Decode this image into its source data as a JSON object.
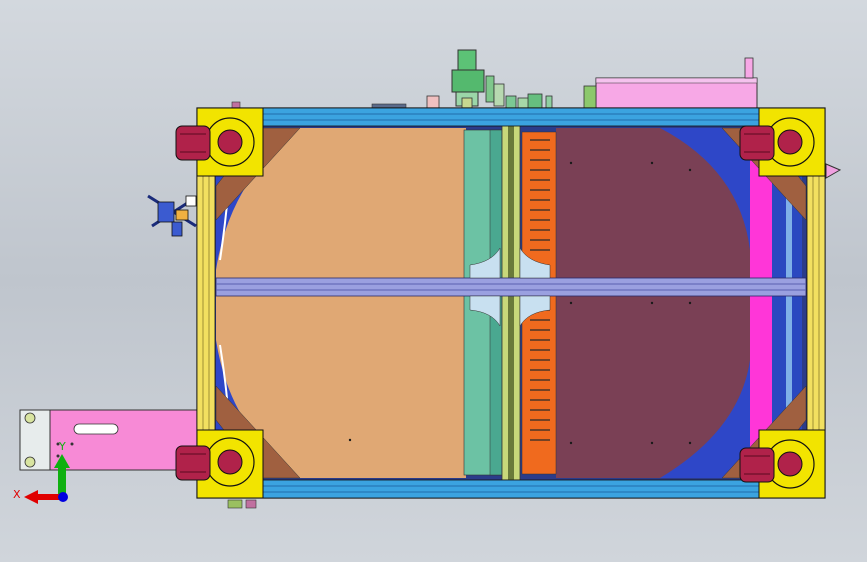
{
  "viewport": {
    "background_top": "#d3d8de",
    "background_bottom": "#bfc5cd"
  },
  "triad": {
    "x_label": "X",
    "y_label": "Y",
    "x_color": "#e00000",
    "y_color": "#10b010",
    "z_color": "#0000e0"
  },
  "colors": {
    "frame_blue": "#3ba3e0",
    "frame_dark": "#1a2b7a",
    "platter_left": "#e0a874",
    "platter_right": "#7a4055",
    "teal_panel": "#6cc2a4",
    "orange_rack": "#f06a1e",
    "caster_red": "#b0224a",
    "corner_yellow": "#f2e400",
    "magenta_panel": "#ff36d8",
    "pink_plate": "#f78ad6",
    "crossbar_lavender": "#9aa0e0"
  },
  "icons": [
    "triad-x-arrow-icon",
    "triad-y-arrow-icon",
    "triad-z-dot-icon",
    "caster-wheel-icon"
  ]
}
